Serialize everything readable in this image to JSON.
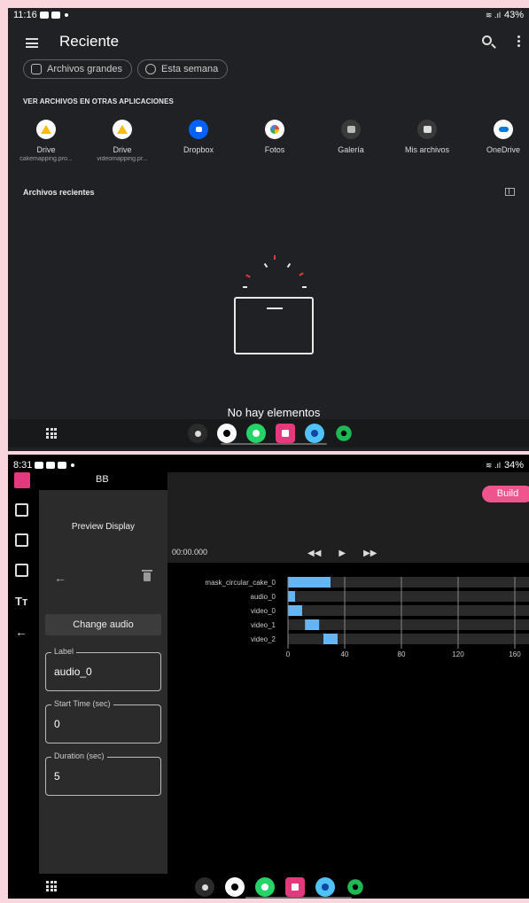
{
  "screen1": {
    "status": {
      "time": "11:16",
      "battery": "43%"
    },
    "title": "Reciente",
    "chips": [
      "Archivos grandes",
      "Esta semana"
    ],
    "section_label": "VER ARCHIVOS EN OTRAS APLICACIONES",
    "apps": [
      {
        "name": "Drive",
        "sub": "cakemapping.pro...",
        "icon": "google-drive-icon",
        "color": "#ffffff"
      },
      {
        "name": "Drive",
        "sub": "videomapping.pr...",
        "icon": "google-drive-icon",
        "color": "#ffffff"
      },
      {
        "name": "Dropbox",
        "sub": "",
        "icon": "dropbox-icon",
        "color": "#0061fe"
      },
      {
        "name": "Fotos",
        "sub": "",
        "icon": "google-photos-icon",
        "color": "#ffffff"
      },
      {
        "name": "Galería",
        "sub": "",
        "icon": "gallery-icon",
        "color": "#3a3a3a"
      },
      {
        "name": "Mis archivos",
        "sub": "",
        "icon": "my-files-icon",
        "color": "#3a3a3a"
      },
      {
        "name": "OneDrive",
        "sub": "",
        "icon": "onedrive-icon",
        "color": "#ffffff"
      }
    ],
    "recent_label": "Archivos recientes",
    "empty_text": "No hay elementos"
  },
  "screen2": {
    "status": {
      "time": "8:31",
      "battery": "34%"
    },
    "project_name": "BB",
    "preview_label": "Preview Display",
    "build_label": "Build",
    "timecode": "00:00.000",
    "transport": {
      "rewind": "◀◀",
      "play": "▶",
      "forward": "▶▶"
    },
    "change_audio_label": "Change audio",
    "fields": [
      {
        "label": "Label",
        "value": "audio_0"
      },
      {
        "label": "Start Time (sec)",
        "value": "0"
      },
      {
        "label": "Duration (sec)",
        "value": "5"
      }
    ],
    "chart_data": {
      "type": "bar",
      "orientation": "horizontal-gantt",
      "categories": [
        "mask_circular_cake_0",
        "audio_0",
        "video_0",
        "video_1",
        "video_2"
      ],
      "series": [
        {
          "start": [
            0,
            0,
            0,
            12,
            25
          ],
          "duration": [
            30,
            5,
            10,
            10,
            10
          ]
        }
      ],
      "x_ticks": [
        0,
        40,
        80,
        120,
        160
      ],
      "xlim": [
        0,
        170
      ],
      "colors": {
        "bar": "#64b5f6",
        "track": "#2a2a2a",
        "accent": "#f0548f"
      }
    }
  },
  "dock_colors": [
    "#2b2b2b",
    "#ffffff",
    "#25d366",
    "#e4397c",
    "#4fc3f7",
    "#1db954"
  ]
}
